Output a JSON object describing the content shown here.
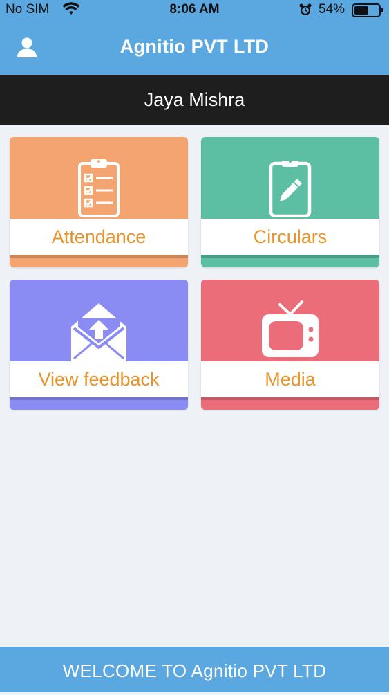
{
  "status_bar": {
    "carrier": "No SIM",
    "time": "8:06 AM",
    "battery": "54%"
  },
  "app_bar": {
    "title": "Agnitio PVT LTD"
  },
  "user_bar": {
    "name": "Jaya Mishra"
  },
  "tiles": [
    {
      "label": "Attendance",
      "icon": "clipboard-checklist-icon",
      "color": "#f4a470"
    },
    {
      "label": "Circulars",
      "icon": "clipboard-pencil-icon",
      "color": "#5cbfa4"
    },
    {
      "label": "View feedback",
      "icon": "envelope-upload-icon",
      "color": "#8a8cf4"
    },
    {
      "label": "Media",
      "icon": "television-icon",
      "color": "#ec6d7a"
    }
  ],
  "colors": {
    "app_bar": "#5aa8df",
    "name_bar": "#1e1e1e",
    "label_text": "#e9942b",
    "background": "#eef1f6"
  },
  "footer": {
    "text": "WELCOME TO Agnitio PVT LTD"
  }
}
